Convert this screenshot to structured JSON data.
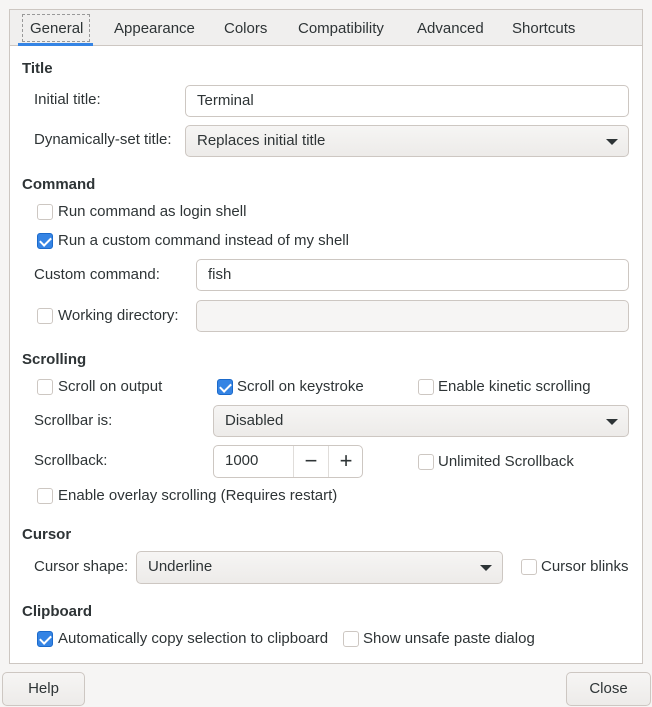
{
  "tabs": [
    "General",
    "Appearance",
    "Colors",
    "Compatibility",
    "Advanced",
    "Shortcuts"
  ],
  "active_tab": "General",
  "accent_color": "#3584e4",
  "title_section": {
    "heading": "Title",
    "initial_title_label": "Initial title:",
    "initial_title_value": "Terminal",
    "dynamic_title_label": "Dynamically-set title:",
    "dynamic_title_value": "Replaces initial title"
  },
  "command_section": {
    "heading": "Command",
    "login_shell": {
      "label": "Run command as login shell",
      "checked": false
    },
    "custom_command_toggle": {
      "label": "Run a custom command instead of my shell",
      "checked": true
    },
    "custom_command_label": "Custom command:",
    "custom_command_value": "fish",
    "working_directory": {
      "label": "Working directory:",
      "checked": false,
      "value": ""
    }
  },
  "scrolling_section": {
    "heading": "Scrolling",
    "scroll_on_output": {
      "label": "Scroll on output",
      "checked": false
    },
    "scroll_on_keystroke": {
      "label": "Scroll on keystroke",
      "checked": true
    },
    "kinetic": {
      "label": "Enable kinetic scrolling",
      "checked": false
    },
    "scrollbar_label": "Scrollbar is:",
    "scrollbar_value": "Disabled",
    "scrollback_label": "Scrollback:",
    "scrollback_value": "1000",
    "minus": "−",
    "plus": "+",
    "unlimited": {
      "label": "Unlimited Scrollback",
      "checked": false
    },
    "overlay": {
      "label": "Enable overlay scrolling (Requires restart)",
      "checked": false
    }
  },
  "cursor_section": {
    "heading": "Cursor",
    "shape_label": "Cursor shape:",
    "shape_value": "Underline",
    "blinks": {
      "label": "Cursor blinks",
      "checked": false
    }
  },
  "clipboard_section": {
    "heading": "Clipboard",
    "auto_copy": {
      "label": "Automatically copy selection to clipboard",
      "checked": true
    },
    "unsafe_paste": {
      "label": "Show unsafe paste dialog",
      "checked": false
    }
  },
  "buttons": {
    "help": "Help",
    "close": "Close"
  }
}
